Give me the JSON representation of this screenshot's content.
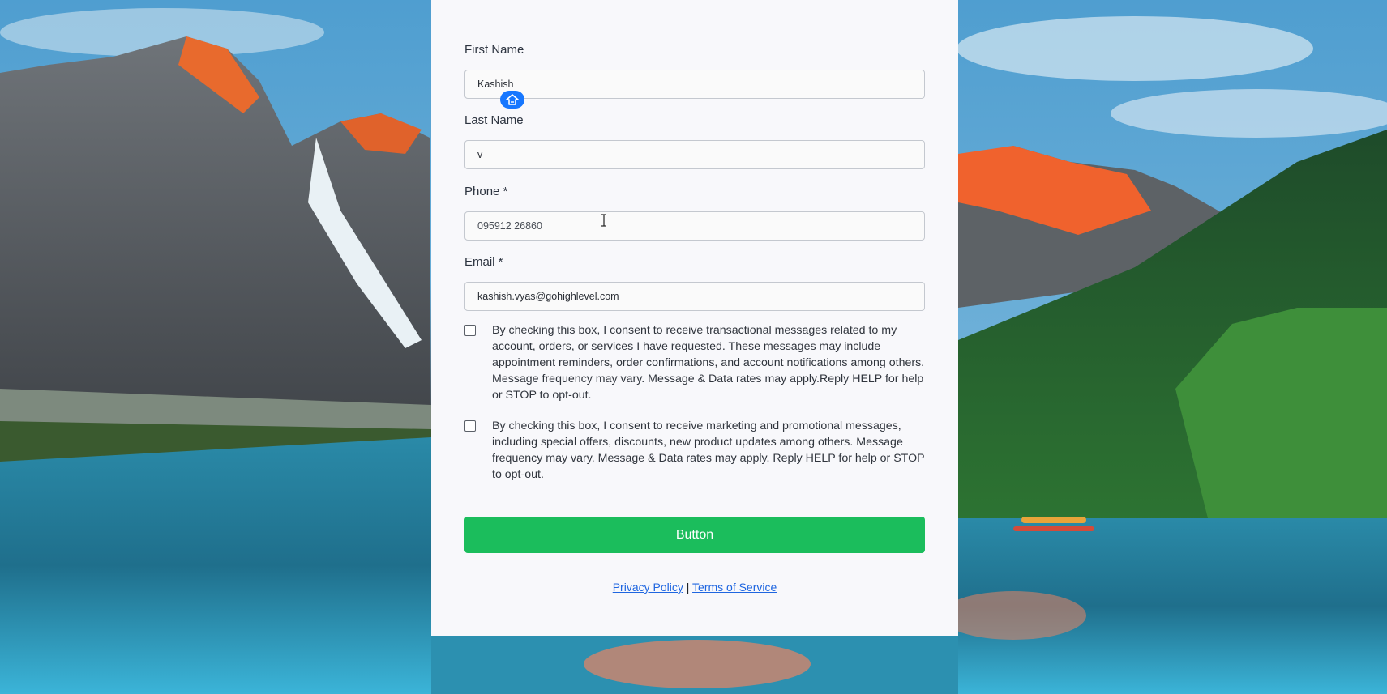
{
  "form": {
    "first_name": {
      "label": "First Name",
      "value": "Kashish"
    },
    "last_name": {
      "label": "Last Name",
      "value": "v"
    },
    "phone": {
      "label": "Phone *",
      "value": "095912 26860"
    },
    "email": {
      "label": "Email *",
      "value": "kashish.vyas@gohighlevel.com"
    },
    "consent_transactional": "By checking this box, I consent to receive transactional messages related to my account, orders, or services I have requested. These messages may include appointment reminders, order confirmations, and account notifications among others. Message frequency may vary. Message & Data rates may apply.Reply HELP for help or STOP to opt-out.",
    "consent_marketing": "By checking this box, I consent to receive marketing and promotional messages, including special offers, discounts, new product updates among others. Message frequency may vary. Message & Data rates may apply. Reply HELP for help or STOP to opt-out.",
    "submit_label": "Button"
  },
  "footer": {
    "privacy_label": "Privacy Policy",
    "separator": "|",
    "terms_label": "Terms of Service"
  },
  "icons": {
    "autofill_badge": "autofill-house-icon",
    "text_cursor": "text-cursor-icon"
  },
  "colors": {
    "button": "#1bbd5c",
    "link": "#1f66e0",
    "badge": "#1677ff",
    "card": "#f8f8fb"
  }
}
